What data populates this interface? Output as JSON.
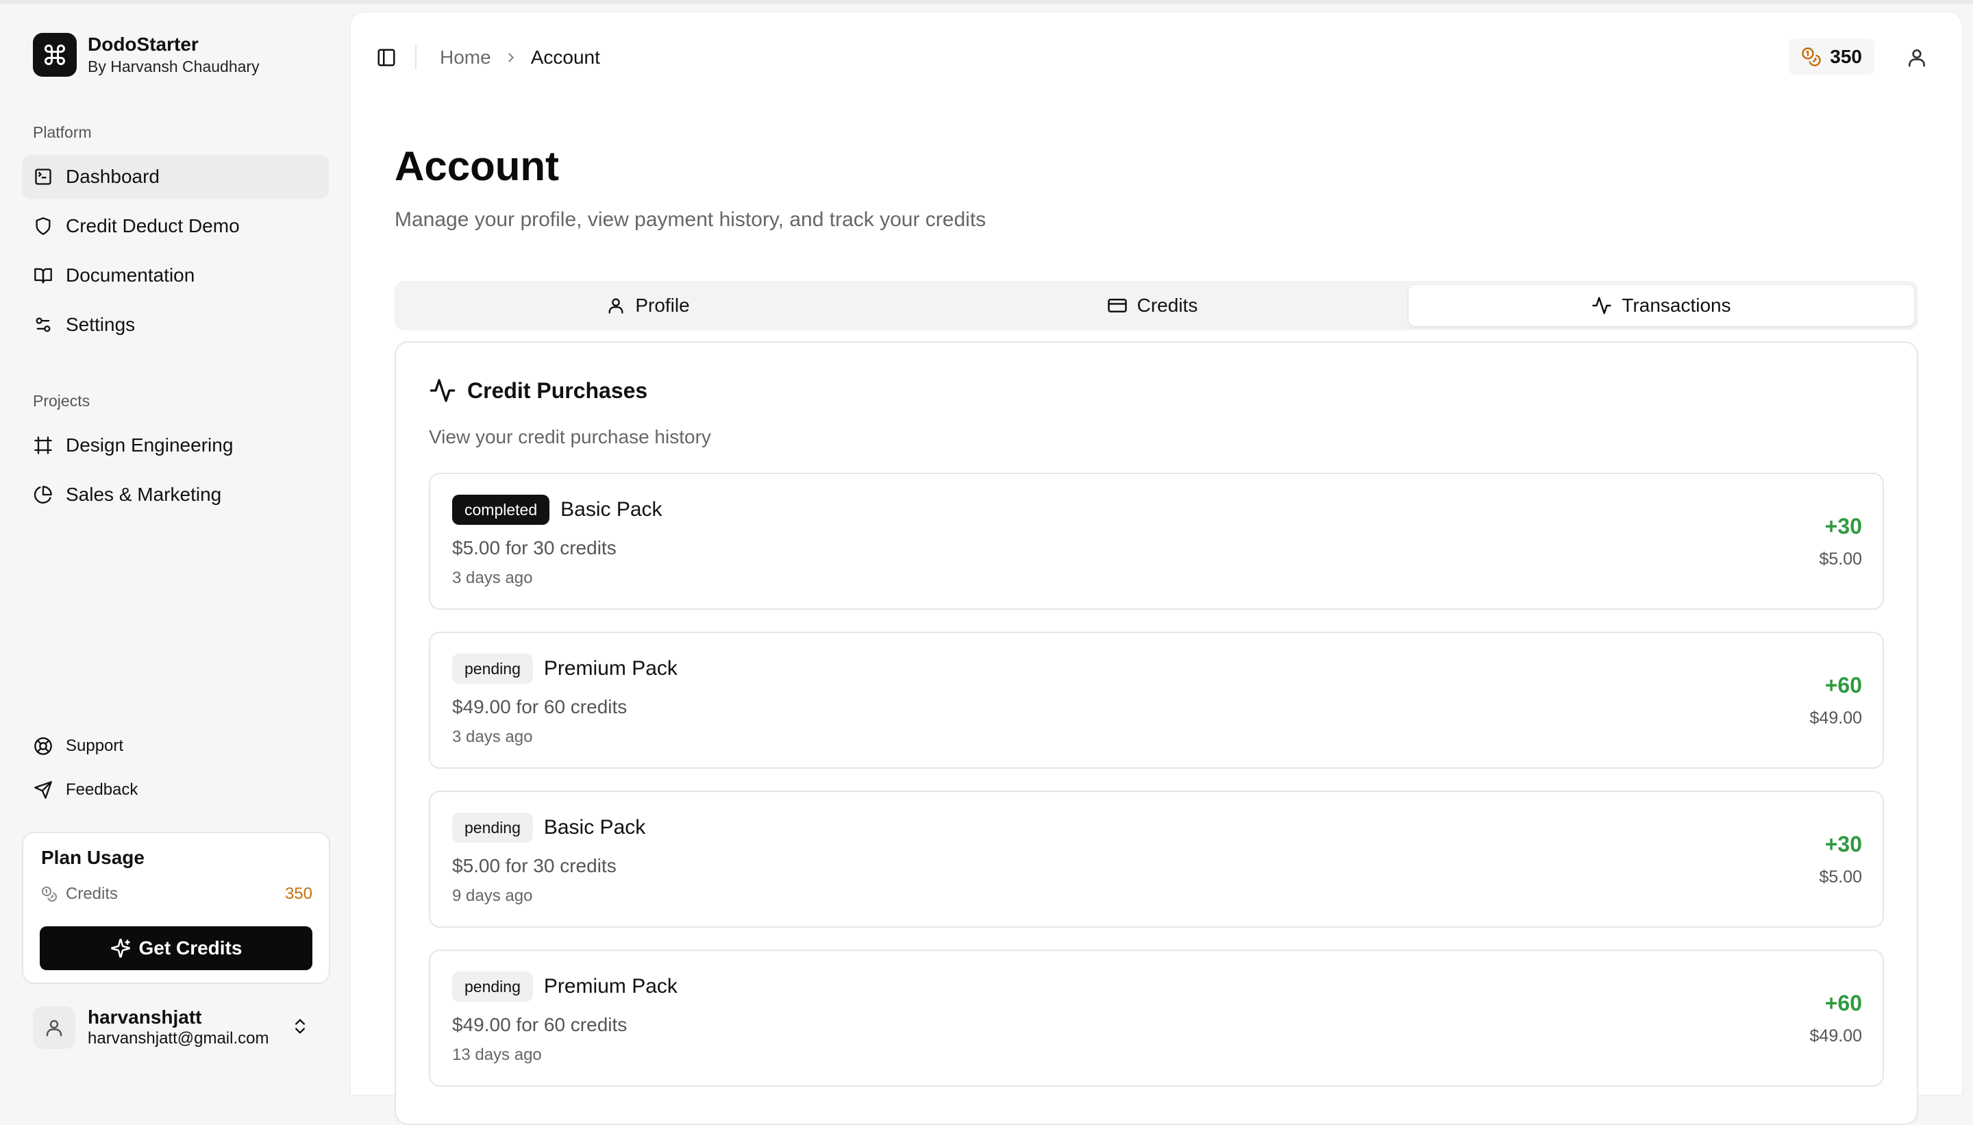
{
  "app": {
    "name": "DodoStarter",
    "subtitle": "By Harvansh Chaudhary"
  },
  "sidebar": {
    "platform_label": "Platform",
    "platform_items": [
      {
        "label": "Dashboard",
        "icon": "terminal-square-icon",
        "active": true
      },
      {
        "label": "Credit Deduct Demo",
        "icon": "shield-icon"
      },
      {
        "label": "Documentation",
        "icon": "book-open-icon"
      },
      {
        "label": "Settings",
        "icon": "settings-sliders-icon"
      }
    ],
    "projects_label": "Projects",
    "project_items": [
      {
        "label": "Design Engineering",
        "icon": "frame-icon"
      },
      {
        "label": "Sales & Marketing",
        "icon": "pie-chart-icon"
      }
    ],
    "secondary_items": [
      {
        "label": "Support",
        "icon": "life-buoy-icon"
      },
      {
        "label": "Feedback",
        "icon": "send-icon"
      }
    ],
    "plan": {
      "title": "Plan Usage",
      "credits_label": "Credits",
      "credits_value": "350",
      "button_label": "Get Credits"
    },
    "user": {
      "name": "harvanshjatt",
      "email": "harvanshjatt@gmail.com"
    }
  },
  "header": {
    "breadcrumb_home": "Home",
    "breadcrumb_current": "Account",
    "credit_balance": "350"
  },
  "page": {
    "title": "Account",
    "description": "Manage your profile, view payment history, and track your credits"
  },
  "tabs": [
    {
      "label": "Profile",
      "icon": "user-icon"
    },
    {
      "label": "Credits",
      "icon": "credit-card-icon"
    },
    {
      "label": "Transactions",
      "icon": "activity-icon",
      "active": true
    }
  ],
  "purchases": {
    "title": "Credit Purchases",
    "description": "View your credit purchase history",
    "items": [
      {
        "status": "completed",
        "pack": "Basic Pack",
        "price_line": "$5.00 for 30 credits",
        "time": "3 days ago",
        "amount": "+30",
        "cost": "$5.00"
      },
      {
        "status": "pending",
        "pack": "Premium Pack",
        "price_line": "$49.00 for 60 credits",
        "time": "3 days ago",
        "amount": "+60",
        "cost": "$49.00"
      },
      {
        "status": "pending",
        "pack": "Basic Pack",
        "price_line": "$5.00 for 30 credits",
        "time": "9 days ago",
        "amount": "+30",
        "cost": "$5.00"
      },
      {
        "status": "pending",
        "pack": "Premium Pack",
        "price_line": "$49.00 for 60 credits",
        "time": "13 days ago",
        "amount": "+60",
        "cost": "$49.00"
      }
    ]
  },
  "colors": {
    "accent_green": "#2f9a3f",
    "credit_orange": "#c56d0a",
    "primary_dark": "#0b0b0c"
  }
}
